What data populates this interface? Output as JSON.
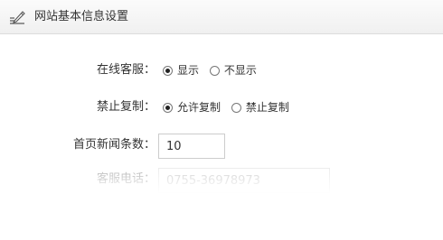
{
  "header": {
    "title": "网站基本信息设置",
    "icon": "edit-icon"
  },
  "form": {
    "online_service": {
      "label": "在线客服：",
      "options": [
        "显示",
        "不显示"
      ],
      "selected": "显示"
    },
    "copy_protection": {
      "label": "禁止复制：",
      "options": [
        "允许复制",
        "禁止复制"
      ],
      "selected": "允许复制"
    },
    "news_count": {
      "label": "首页新闻条数：",
      "value": "10"
    },
    "service_phone": {
      "label": "客服电话：",
      "value": "0755-36978973"
    }
  }
}
